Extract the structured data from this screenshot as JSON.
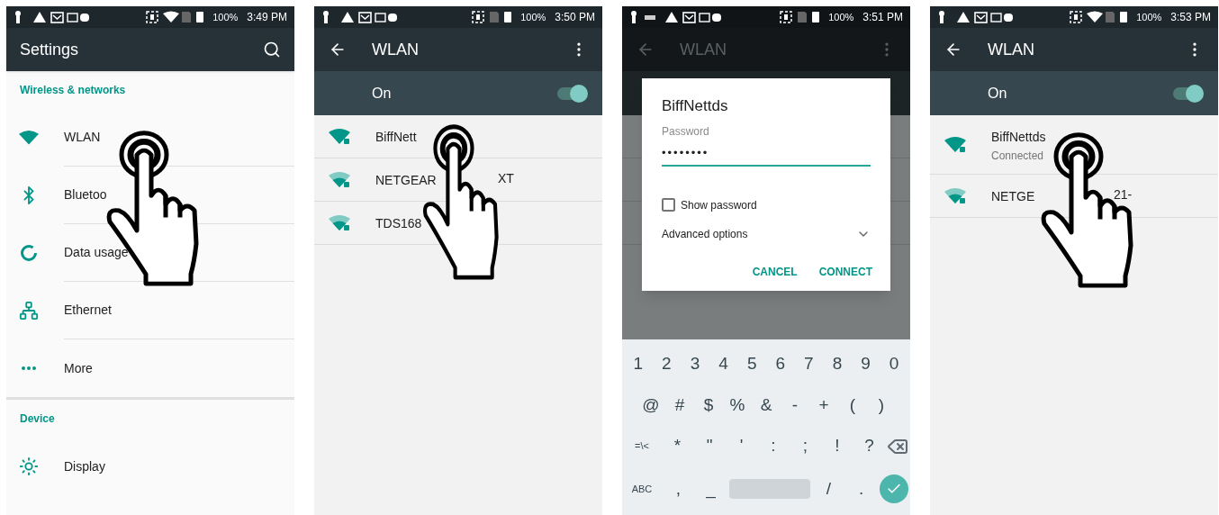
{
  "panels": [
    {
      "kind": "settings",
      "status": {
        "battery": "100%",
        "time": "3:49 PM",
        "wifi": true,
        "keyboard": false
      },
      "title": "Settings",
      "hand": true,
      "sections": [
        {
          "heading": "Wireless & networks",
          "items": [
            {
              "kind": "wifi",
              "label": "WLAN"
            },
            {
              "kind": "bluetooth",
              "label": "Bluetoo"
            },
            {
              "kind": "data",
              "label": "Data usage"
            },
            {
              "kind": "ethernet",
              "label": "Ethernet"
            },
            {
              "kind": "more",
              "label": "More"
            }
          ]
        },
        {
          "heading": "Device",
          "items": [
            {
              "kind": "display",
              "label": "Display"
            }
          ]
        }
      ]
    },
    {
      "kind": "wlan",
      "status": {
        "battery": "100%",
        "time": "3:50 PM",
        "wifi": false,
        "keyboard": false
      },
      "title": "WLAN",
      "hand": true,
      "switch": {
        "label": "On",
        "on": true
      },
      "networks": [
        {
          "kind": "full",
          "name": "BiffNett"
        },
        {
          "kind": "partial",
          "name": "NETGEAR",
          "tail": "XT"
        },
        {
          "kind": "partial",
          "name": "TDS168"
        }
      ]
    },
    {
      "kind": "dialog",
      "status": {
        "battery": "100%",
        "time": "3:51 PM",
        "wifi": false,
        "keyboard": true
      },
      "title": "WLAN",
      "dialog": {
        "title": "BiffNettds",
        "field_label": "Password",
        "value": "••••••••",
        "show_password": {
          "label": "Show password",
          "checked": false
        },
        "advanced": "Advanced options",
        "buttons": [
          "CANCEL",
          "CONNECT"
        ]
      },
      "keyboard": [
        [
          {
            "kind": "char",
            "label": "1"
          },
          {
            "kind": "char",
            "label": "2"
          },
          {
            "kind": "char",
            "label": "3"
          },
          {
            "kind": "char",
            "label": "4"
          },
          {
            "kind": "char",
            "label": "5"
          },
          {
            "kind": "char",
            "label": "6"
          },
          {
            "kind": "char",
            "label": "7"
          },
          {
            "kind": "char",
            "label": "8"
          },
          {
            "kind": "char",
            "label": "9"
          },
          {
            "kind": "char",
            "label": "0"
          }
        ],
        [
          {
            "kind": "char",
            "label": "@"
          },
          {
            "kind": "char",
            "label": "#"
          },
          {
            "kind": "char",
            "label": "$"
          },
          {
            "kind": "char",
            "label": "%"
          },
          {
            "kind": "char",
            "label": "&"
          },
          {
            "kind": "char",
            "label": "-"
          },
          {
            "kind": "char",
            "label": "+"
          },
          {
            "kind": "char",
            "label": "("
          },
          {
            "kind": "char",
            "label": ")"
          }
        ],
        [
          {
            "kind": "small",
            "label": "=\\<"
          },
          {
            "kind": "char",
            "label": "*"
          },
          {
            "kind": "char",
            "label": "\""
          },
          {
            "kind": "char",
            "label": "'"
          },
          {
            "kind": "char",
            "label": ":"
          },
          {
            "kind": "char",
            "label": ";"
          },
          {
            "kind": "char",
            "label": "!"
          },
          {
            "kind": "char",
            "label": "?"
          },
          {
            "kind": "backspace"
          }
        ],
        [
          {
            "kind": "small",
            "label": "ABC"
          },
          {
            "kind": "char",
            "label": ","
          },
          {
            "kind": "char",
            "label": "_"
          },
          {
            "kind": "space"
          },
          {
            "kind": "char",
            "label": "/"
          },
          {
            "kind": "char",
            "label": "."
          },
          {
            "kind": "enter"
          }
        ]
      ]
    },
    {
      "kind": "wlan",
      "status": {
        "battery": "100%",
        "time": "3:53 PM",
        "wifi": true,
        "keyboard": false
      },
      "title": "WLAN",
      "hand": true,
      "switch": {
        "label": "On",
        "on": true
      },
      "networks": [
        {
          "kind": "full",
          "name": "BiffNettds",
          "subtitle": "Connected"
        },
        {
          "kind": "partial",
          "name": "NETGE",
          "tail": "21-"
        }
      ]
    }
  ]
}
